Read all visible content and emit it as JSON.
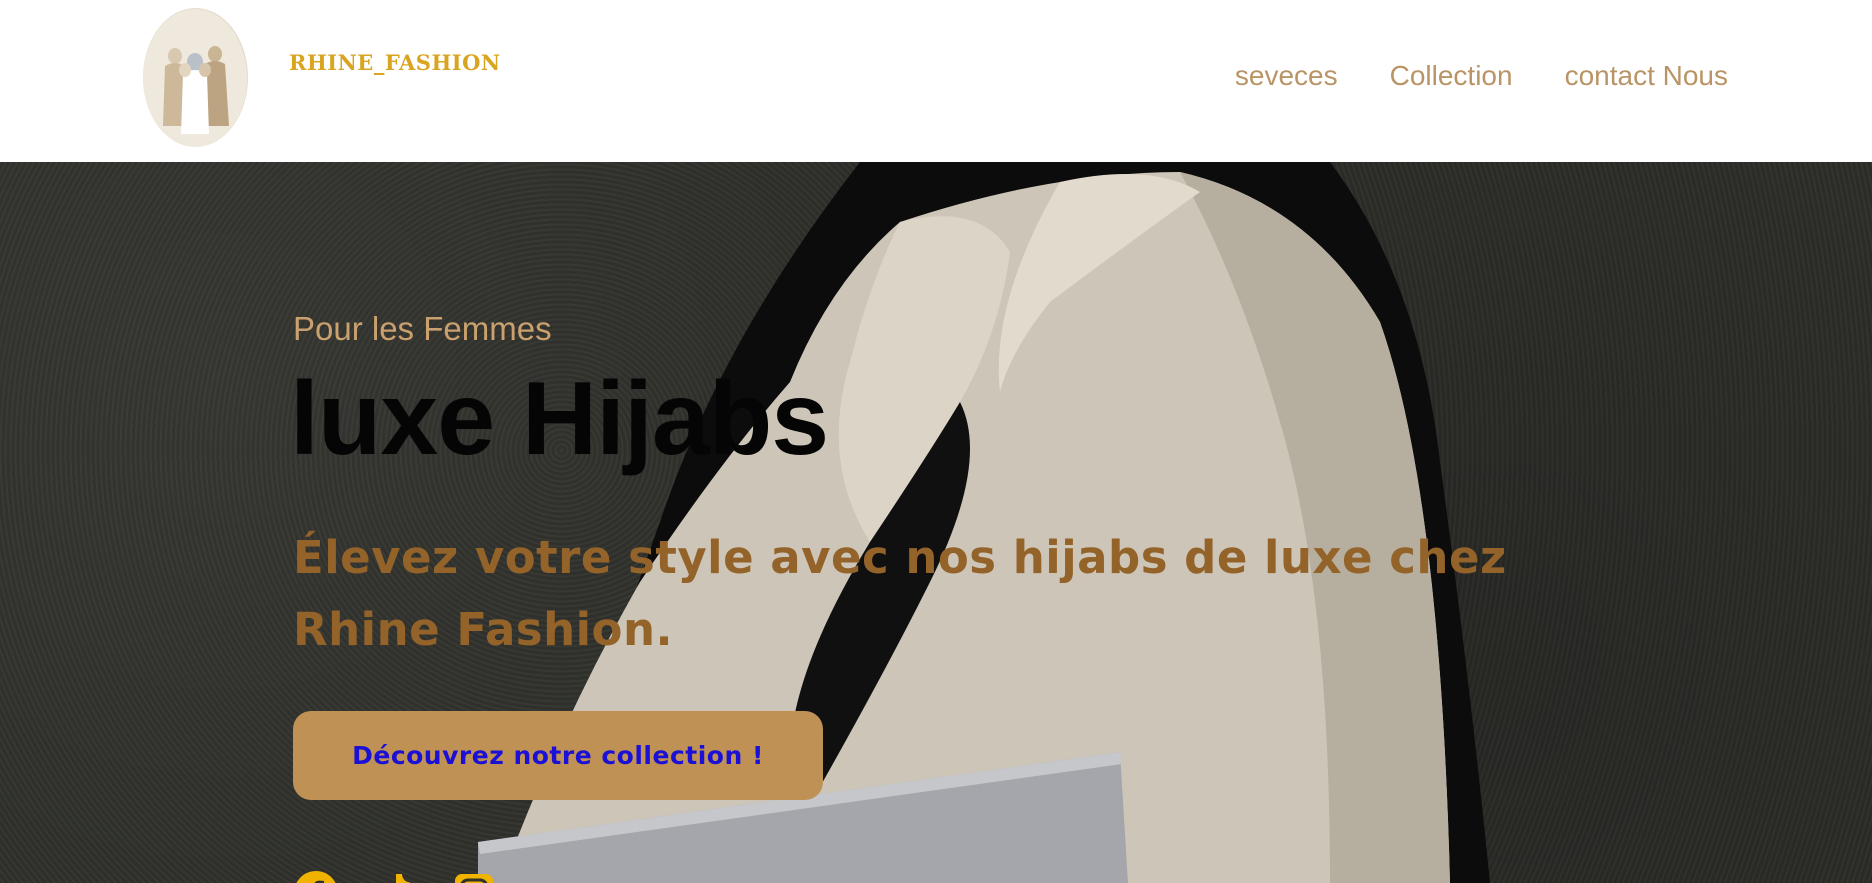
{
  "brand": {
    "name": "RHINE_FASHION"
  },
  "nav": {
    "items": [
      "seveces",
      "Collection",
      "contact Nous"
    ]
  },
  "hero": {
    "kicker": "Pour les Femmes",
    "title": "luxe Hijabs",
    "subtitle": "Élevez votre style avec nos hijabs de luxe chez Rhine Fashion.",
    "cta_label": "Découvrez notre collection !"
  },
  "socials": {
    "icons": [
      "facebook-icon",
      "tiktok-icon",
      "instagram-icon"
    ],
    "color": "#f0b400"
  },
  "colors": {
    "brand_gold": "#d9a520",
    "nav_text": "#b99466",
    "kicker": "#c9a06e",
    "subtitle": "#94632a",
    "cta_bg": "#bf9155",
    "cta_text": "#1b10d6"
  }
}
